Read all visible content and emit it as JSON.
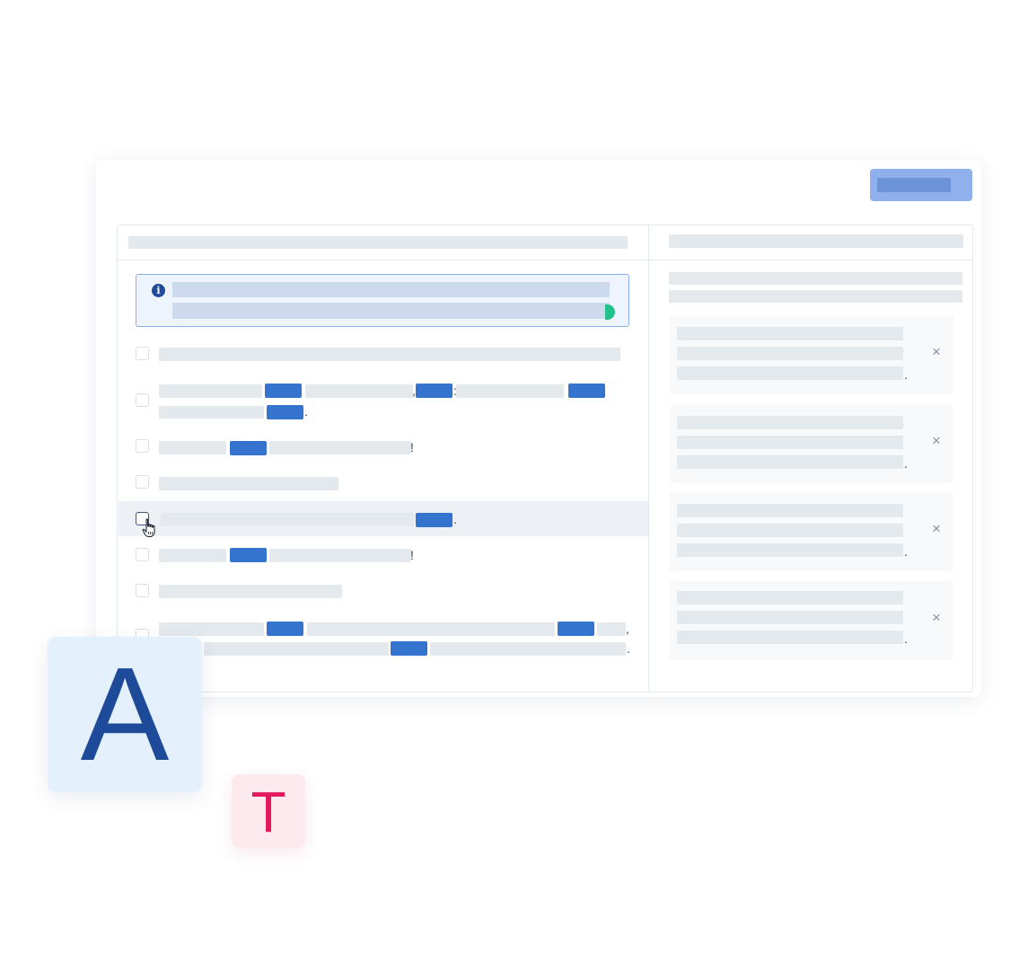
{
  "toolbar": {
    "primary_action": ""
  },
  "notice": {
    "icon": "info-icon",
    "status_color": "#22c08a"
  },
  "punctuation": {
    "r2a": ",",
    "r2b": ":",
    "r2c": ".",
    "r3": "!",
    "r5": ".",
    "r6": "!",
    "r8a": ",",
    "r8b": "."
  },
  "comments": [
    {
      "close": "×",
      "dot": "."
    },
    {
      "close": "×",
      "dot": "."
    },
    {
      "close": "×",
      "dot": "."
    },
    {
      "close": "×",
      "dot": "."
    }
  ],
  "tiles": {
    "a_letter": "A",
    "t_letter": "T"
  },
  "colors": {
    "accent": "#3474cf",
    "brand_dark": "#1e4a9a",
    "tag_pink": "#e21a5c"
  }
}
